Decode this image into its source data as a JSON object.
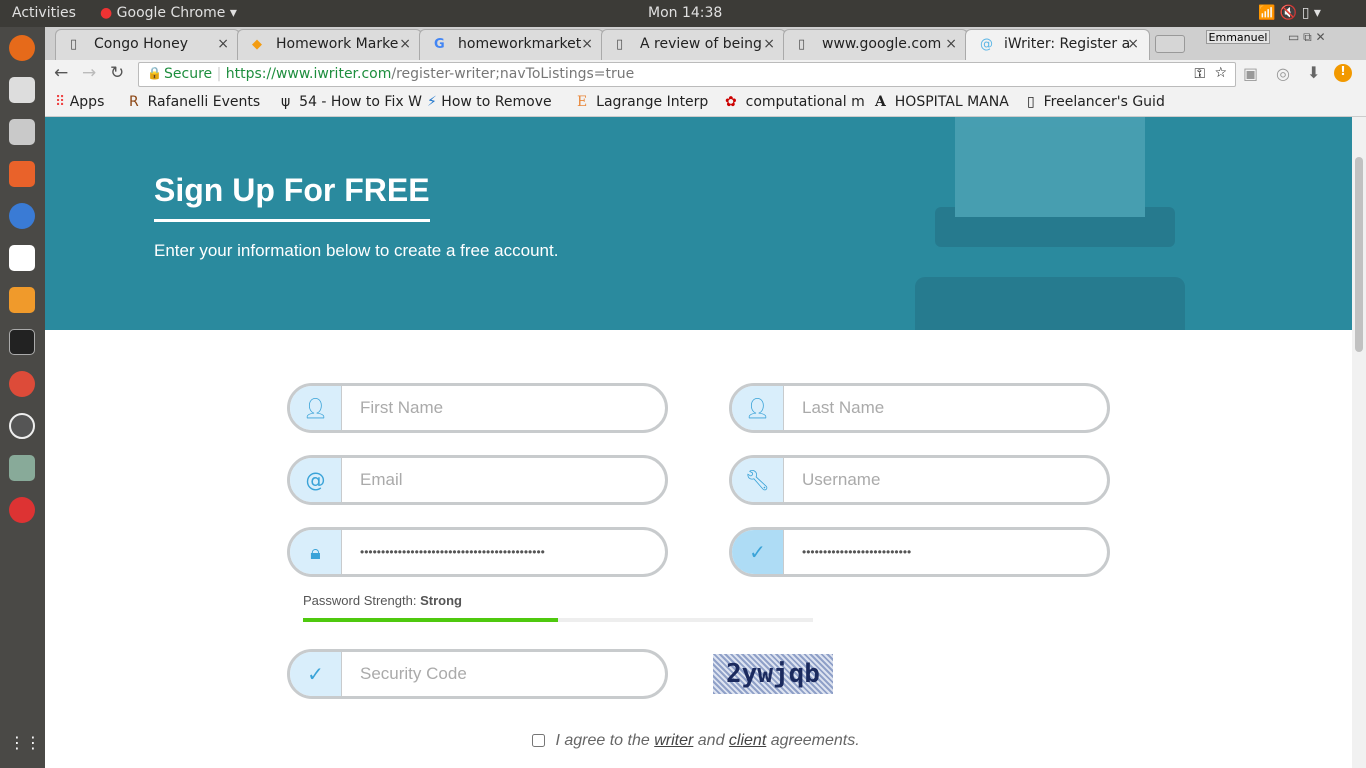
{
  "system": {
    "activities": "Activities",
    "app": "Google Chrome ▾",
    "clock": "Mon 14:38"
  },
  "tabs": [
    {
      "title": "Congo Honey",
      "icon": "page-icon"
    },
    {
      "title": "Homework Marke",
      "icon": "homework-market-icon"
    },
    {
      "title": "homeworkmarket",
      "icon": "google-icon"
    },
    {
      "title": "A review of being",
      "icon": "page-icon"
    },
    {
      "title": "www.google.com",
      "icon": "page-icon"
    },
    {
      "title": "iWriter: Register a",
      "icon": "at-icon",
      "active": true
    }
  ],
  "profile": "Emmanuel",
  "omnibox": {
    "secure": "Secure",
    "url_host": "https://www.iwriter.com",
    "url_path": "/register-writer;navToListings=true"
  },
  "bookmarks": [
    "Apps",
    "Rafanelli Events",
    "54 - How to Fix W",
    "How to Remove",
    "Lagrange Interp",
    "computational m",
    "HOSPITAL MANA",
    "Freelancer's Guid"
  ],
  "hero": {
    "title": "Sign Up For FREE",
    "subtitle": "Enter your information below to create a free account."
  },
  "form": {
    "first_name": {
      "placeholder": "First Name"
    },
    "last_name": {
      "placeholder": "Last Name"
    },
    "email": {
      "placeholder": "Email"
    },
    "username": {
      "placeholder": "Username"
    },
    "password": {
      "value": "••••••••••••••••••••••••••••••••••••••••••••"
    },
    "confirm_password": {
      "value": "••••••••••••••••••••••••••"
    },
    "strength_label": "Password Strength:",
    "strength_value": "Strong",
    "strength_fraction": 0.5,
    "security_code": {
      "placeholder": "Security Code"
    },
    "captcha": "2ywjqb",
    "agree_pre": "I agree to the",
    "agree_writer": "writer",
    "agree_and": "and",
    "agree_client": "client",
    "agree_post": "agreements."
  },
  "colors": {
    "hero": "#2a8a9e",
    "strength": "#4fc90e",
    "icon_bg": "#d9eefb"
  }
}
